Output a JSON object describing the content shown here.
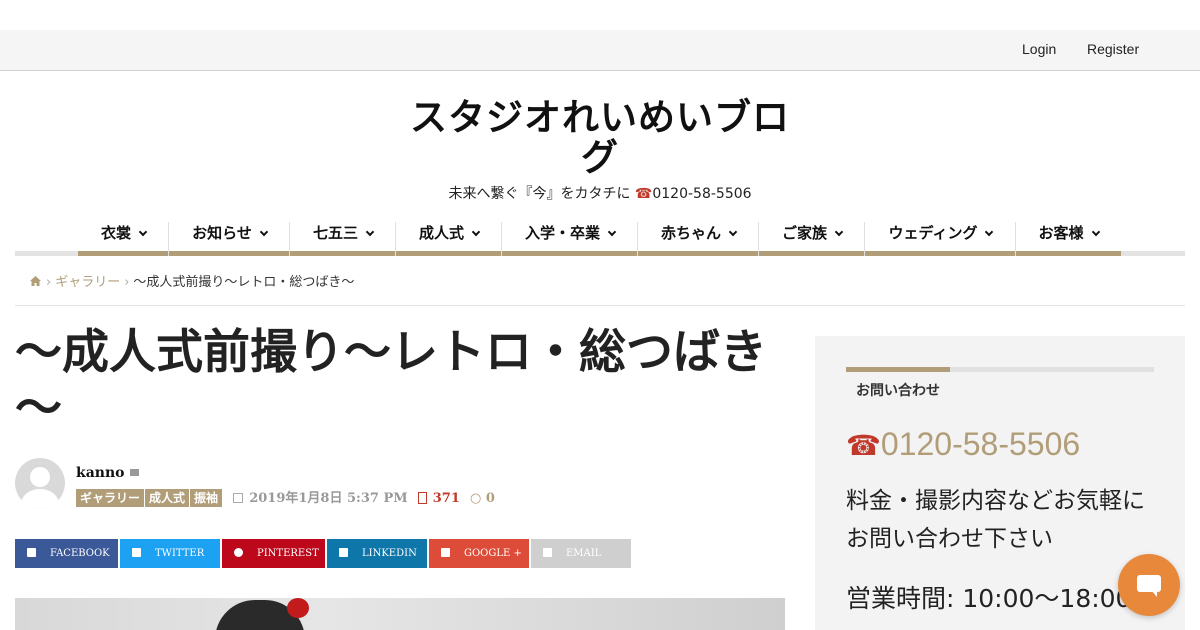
{
  "topbar": {
    "login": "Login",
    "register": "Register"
  },
  "site": {
    "title": "スタジオれいめいブログ",
    "tagline_text": "未来へ繋ぐ『今』をカタチに ",
    "tagline_tel_icon": "☎",
    "tagline_phone": "0120-58-5506"
  },
  "nav": {
    "items": [
      {
        "label": "衣裳"
      },
      {
        "label": "お知らせ"
      },
      {
        "label": "七五三"
      },
      {
        "label": "成人式"
      },
      {
        "label": "入学・卒業"
      },
      {
        "label": "赤ちゃん"
      },
      {
        "label": "ご家族"
      },
      {
        "label": "ウェディング"
      },
      {
        "label": "お客様"
      }
    ]
  },
  "breadcrumb": {
    "link": "ギャラリー",
    "current": "～成人式前撮り～レトロ・総つばき～"
  },
  "post": {
    "title": "～成人式前撮り～レトロ・総つばき～",
    "author": "kanno",
    "tags": [
      "ギャラリー",
      "成人式",
      "振袖"
    ],
    "date": "2019年1月8日 5:37 PM",
    "views": "371",
    "comments": "0"
  },
  "share": {
    "facebook": "FACEBOOK",
    "twitter": "TWITTER",
    "pinterest": "PINTEREST",
    "linkedin": "LINKEDIN",
    "google": "GOOGLE +",
    "email": "EMAIL"
  },
  "sidebar": {
    "heading": "お問い合わせ",
    "tel_icon": "☎",
    "phone": "0120-58-5506",
    "text": "料金・撮影内容などお気軽にお問い合わせ下さい",
    "hours": "営業時間: 10:00〜18:00"
  },
  "colors": {
    "accent": "#b19d78",
    "chat": "#e8883a",
    "tel": "#c0392b"
  }
}
